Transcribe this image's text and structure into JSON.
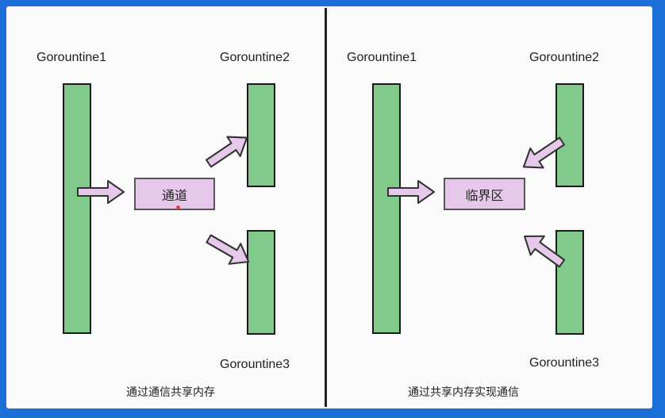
{
  "left_panel": {
    "goroutine1": "Gorountine1",
    "goroutine2": "Gorountine2",
    "goroutine3": "Gorountine3",
    "box_label": "通道",
    "caption": "通过通信共享内存"
  },
  "right_panel": {
    "goroutine1": "Gorountine1",
    "goroutine2": "Gorountine2",
    "goroutine3": "Gorountine3",
    "box_label": "临界区",
    "caption": "通过共享内存实现通信"
  },
  "colors": {
    "frame": "#1c6fd6",
    "bar_fill": "#82c98c",
    "box_fill": "#e6c9ea",
    "arrow_fill": "#e6c9ea"
  }
}
